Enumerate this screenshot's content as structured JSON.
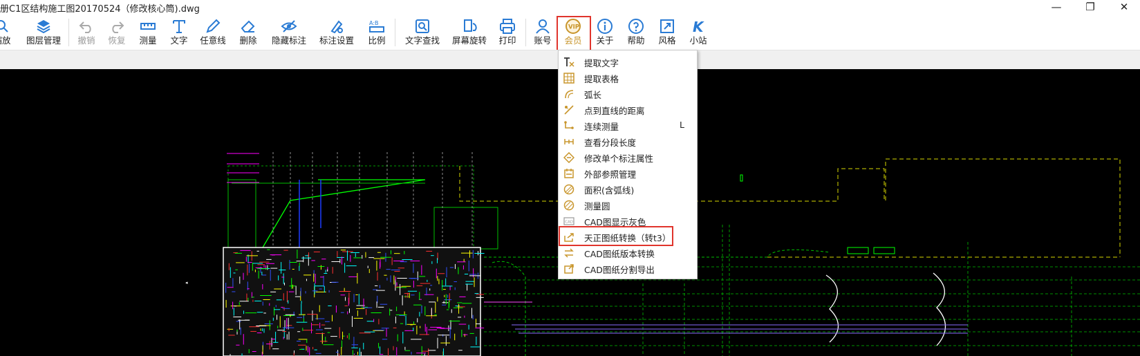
{
  "window": {
    "title": "册C1区结构施工图20170524（修改核心筒).dwg",
    "minimize": "—",
    "restore": "❐",
    "close": "✕"
  },
  "toolbar": {
    "items": [
      {
        "label": "缩放",
        "icon": "zoom-icon"
      },
      {
        "label": "图层管理",
        "icon": "layers-icon"
      },
      {
        "label": "撤销",
        "icon": "undo-icon"
      },
      {
        "label": "恢复",
        "icon": "redo-icon"
      },
      {
        "label": "测量",
        "icon": "measure-icon"
      },
      {
        "label": "文字",
        "icon": "text-icon"
      },
      {
        "label": "任意线",
        "icon": "pen-icon"
      },
      {
        "label": "删除",
        "icon": "eraser-icon"
      },
      {
        "label": "隐藏标注",
        "icon": "eye-icon"
      },
      {
        "label": "标注设置",
        "icon": "annotation-settings-icon"
      },
      {
        "label": "比例",
        "icon": "scale-icon"
      },
      {
        "label": "文字查找",
        "icon": "text-search-icon"
      },
      {
        "label": "屏幕旋转",
        "icon": "rotate-screen-icon"
      },
      {
        "label": "打印",
        "icon": "printer-icon"
      },
      {
        "label": "账号",
        "icon": "account-icon"
      },
      {
        "label": "会员",
        "icon": "vip-icon",
        "badge": "VIP"
      },
      {
        "label": "关于",
        "icon": "info-icon"
      },
      {
        "label": "帮助",
        "icon": "help-icon"
      },
      {
        "label": "风格",
        "icon": "style-icon"
      },
      {
        "label": "小站",
        "icon": "site-icon",
        "badge": "K"
      }
    ]
  },
  "member_menu": {
    "items": [
      {
        "label": "提取文字",
        "icon": "extract-text-icon",
        "shortcut": ""
      },
      {
        "label": "提取表格",
        "icon": "extract-table-icon",
        "shortcut": ""
      },
      {
        "label": "弧长",
        "icon": "arc-length-icon",
        "shortcut": ""
      },
      {
        "label": "点到直线的距离",
        "icon": "point-line-distance-icon",
        "shortcut": ""
      },
      {
        "label": "连续测量",
        "icon": "continuous-measure-icon",
        "shortcut": "L"
      },
      {
        "label": "查看分段长度",
        "icon": "segment-length-icon",
        "shortcut": ""
      },
      {
        "label": "修改单个标注属性",
        "icon": "edit-annotation-icon",
        "shortcut": ""
      },
      {
        "label": "外部参照管理",
        "icon": "xref-icon",
        "shortcut": ""
      },
      {
        "label": "面积(含弧线)",
        "icon": "area-icon",
        "shortcut": ""
      },
      {
        "label": "测量圆",
        "icon": "measure-circle-icon",
        "shortcut": ""
      },
      {
        "label": "CAD图显示灰色",
        "icon": "cad-gray-icon",
        "shortcut": ""
      },
      {
        "label": "天正图纸转换（转t3）",
        "icon": "tangent-convert-icon",
        "shortcut": ""
      },
      {
        "label": "CAD图纸版本转换",
        "icon": "version-convert-icon",
        "shortcut": ""
      },
      {
        "label": "CAD图纸分割导出",
        "icon": "split-export-icon",
        "shortcut": ""
      }
    ]
  },
  "colors": {
    "accent": "#2a7bd4",
    "highlight_box": "#e0342c",
    "vip_gold": "#c8952b",
    "canvas": "#000000"
  }
}
